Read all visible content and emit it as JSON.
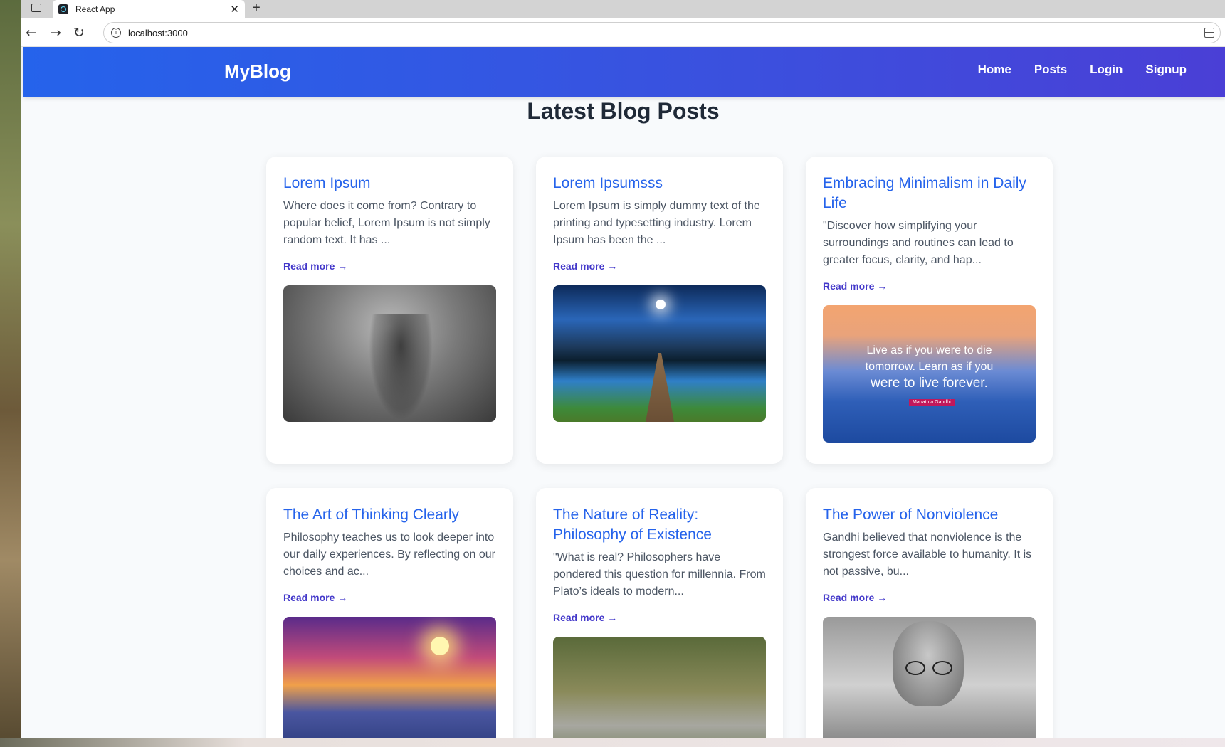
{
  "browser": {
    "tab_title": "React App",
    "tab_close": "✕",
    "new_tab": "+",
    "url": "localhost:3000",
    "back": "←",
    "forward": "→",
    "reload": "↻",
    "info": "i"
  },
  "nav": {
    "brand": "MyBlog",
    "links": [
      "Home",
      "Posts",
      "Login",
      "Signup"
    ]
  },
  "page": {
    "heading": "Latest Blog Posts"
  },
  "posts": [
    {
      "title": "Lorem Ipsum",
      "excerpt": "Where does it come from? Contrary to popular belief, Lorem Ipsum is not simply random text. It has ...",
      "read_more": "Read more →",
      "image": "forest-fog-image"
    },
    {
      "title": "Lorem Ipsumsss",
      "excerpt": "Lorem Ipsum is simply dummy text of the printing and typesetting industry. Lorem Ipsum has been the ...",
      "read_more": "Read more →",
      "image": "lake-dock-night-image"
    },
    {
      "title": "Embracing Minimalism in Daily Life",
      "excerpt": "\"Discover how simplifying your surroundings and routines can lead to greater focus, clarity, and hap...",
      "read_more": "Read more →",
      "image": "quote-mountains-image",
      "image_quote_line1": "Live as if you were to die",
      "image_quote_line2": "tomorrow. Learn as if you",
      "image_quote_line3": "were to live forever.",
      "image_quote_author": "Mahatma Gandhi"
    },
    {
      "title": "The Art of Thinking Clearly",
      "excerpt": "Philosophy teaches us to look deeper into our daily experiences. By reflecting on our choices and ac...",
      "read_more": "Read more →",
      "image": "sunset-mountains-image"
    },
    {
      "title": "The Nature of Reality: Philosophy of Existence",
      "excerpt": "\"What is real? Philosophers have pondered this question for millennia. From Plato’s ideals to modern...",
      "read_more": "Read more →",
      "image": "stream-flowers-image"
    },
    {
      "title": "The Power of Nonviolence",
      "excerpt": "Gandhi believed that nonviolence is the strongest force available to humanity. It is not passive, bu...",
      "read_more": "Read more →",
      "image": "gandhi-portrait-image"
    }
  ],
  "colors": {
    "accent": "#2563eb",
    "nav_gradient_end": "#4a3fd6",
    "read_more": "#4338ca",
    "heading": "#1f2937",
    "background": "#f8fafc"
  }
}
